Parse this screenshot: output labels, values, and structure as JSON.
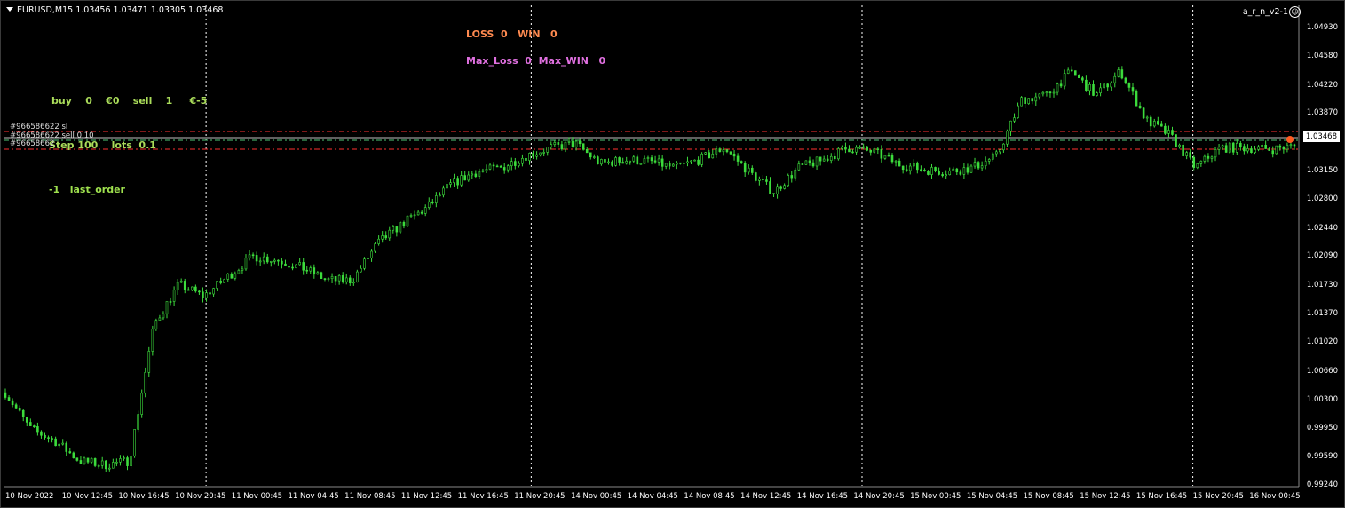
{
  "chart_data": {
    "type": "line",
    "title": "EURUSD,M15",
    "ohlc_header": "1.03456 1.03471 1.03305 1.03468",
    "symbol": "EURUSD",
    "timeframe": "M15",
    "ylim": [
      0.9924,
      1.052
    ],
    "x": [
      "10 Nov 2022",
      "10 Nov 12:45",
      "10 Nov 16:45",
      "10 Nov 20:45",
      "11 Nov 00:45",
      "11 Nov 04:45",
      "11 Nov 08:45",
      "11 Nov 12:45",
      "11 Nov 16:45",
      "11 Nov 20:45",
      "14 Nov 00:45",
      "14 Nov 04:45",
      "14 Nov 08:45",
      "14 Nov 12:45",
      "14 Nov 16:45",
      "14 Nov 20:45",
      "15 Nov 00:45",
      "15 Nov 04:45",
      "15 Nov 08:45",
      "15 Nov 12:45",
      "15 Nov 16:45",
      "15 Nov 20:45",
      "16 Nov 00:45"
    ],
    "series": [
      {
        "values": [
          1.004,
          0.9995,
          0.998,
          0.9955,
          0.995,
          0.9955,
          1.0125,
          1.0175,
          1.016,
          1.0185,
          1.021,
          1.0205,
          1.0195,
          1.018,
          1.018,
          1.0225,
          1.025,
          1.027,
          1.03,
          1.0315,
          1.032,
          1.0335,
          1.0345,
          1.035,
          1.0325,
          1.033,
          1.0328,
          1.032,
          1.033,
          1.0345,
          1.0315,
          1.029,
          1.032,
          1.033,
          1.0345,
          1.034,
          1.0325,
          1.0318,
          1.0315,
          1.032,
          1.0335,
          1.0405,
          1.041,
          1.044,
          1.041,
          1.044,
          1.038,
          1.036,
          1.032,
          1.0345,
          1.0345,
          1.0343,
          1.0347
        ]
      }
    ],
    "y_ticks": [
      "1.04930",
      "1.04580",
      "1.04220",
      "1.03870",
      "1.03150",
      "1.02800",
      "1.02440",
      "1.02090",
      "1.01730",
      "1.01370",
      "1.01020",
      "1.00660",
      "1.00300",
      "0.99950",
      "0.99590",
      "0.99240"
    ],
    "current_price": "1.03468",
    "grid": false,
    "colors": {
      "candles": "#3cdc3c",
      "sl_line": "#ff3030",
      "order_line": "#50c878",
      "price_line": "#c0c0c0",
      "separator": "#ffffff"
    }
  },
  "window": {
    "title": "EURUSD,M15",
    "ohlc": "1.03456 1.03471 1.03305 1.03468",
    "ea_name": "a_r_n_v2-1",
    "ea_icon": "smiley-icon"
  },
  "panel": {
    "loss_win": "LOSS  0   WIN   0",
    "max_loss_win": "Max_Loss  0  Max_WIN   0",
    "buy_sell": "buy    0    €0    sell    1     €-5",
    "step_lots": "Step 100    lots  0.1",
    "last_order": "-1   last_order"
  },
  "order_lines": {
    "sl_label": "#966586622 sl",
    "sell_label": "#966586622 sell 0.10",
    "third_label": "#96658662"
  }
}
